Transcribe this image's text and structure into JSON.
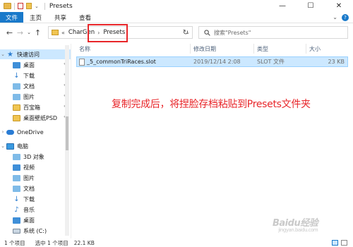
{
  "window": {
    "title": "Presets",
    "controls": {
      "minimize": "—",
      "maximize": "☐",
      "close": "✕"
    }
  },
  "ribbon": {
    "tabs": [
      "文件",
      "主页",
      "共享",
      "查看"
    ],
    "expand_glyph": "⌄",
    "help_glyph": "?"
  },
  "address": {
    "back": "←",
    "forward": "→",
    "recent": "⌄",
    "up": "↑",
    "overflow": "«",
    "crumbs": [
      "CharGen",
      "Presets"
    ],
    "separator": "›",
    "dropdown": "⌄",
    "refresh": "↻"
  },
  "search": {
    "placeholder": "搜索\"Presets\""
  },
  "sidebar": {
    "quick_access": "快速访问",
    "quick_items": [
      {
        "label": "桌面",
        "icon": "desktop-icon",
        "pinned": true
      },
      {
        "label": "下载",
        "icon": "download-icon",
        "pinned": true
      },
      {
        "label": "文档",
        "icon": "documents-icon",
        "pinned": true
      },
      {
        "label": "图片",
        "icon": "pictures-icon",
        "pinned": true
      },
      {
        "label": "百宝箱",
        "icon": "folder-icon",
        "pinned": true
      },
      {
        "label": "桌面壁纸PSD",
        "icon": "folder-icon",
        "pinned": true
      }
    ],
    "onedrive": "OneDrive",
    "this_pc": "电脑",
    "pc_items": [
      {
        "label": "3D 对象",
        "icon": "3d-objects-icon"
      },
      {
        "label": "视频",
        "icon": "videos-icon"
      },
      {
        "label": "图片",
        "icon": "pictures-icon"
      },
      {
        "label": "文档",
        "icon": "documents-icon"
      },
      {
        "label": "下载",
        "icon": "download-icon"
      },
      {
        "label": "音乐",
        "icon": "music-icon"
      },
      {
        "label": "桌面",
        "icon": "desktop-icon"
      },
      {
        "label": "系统 (C:)",
        "icon": "drive-icon"
      }
    ]
  },
  "columns": {
    "name": "名称",
    "modified": "修改日期",
    "type": "类型",
    "size": "大小"
  },
  "files": [
    {
      "name": "_5_commonTriRaces.slot",
      "modified": "2019/12/14 2:08",
      "type": "SLOT 文件",
      "size": "23 KB"
    }
  ],
  "annotation": "复制完成后，将捏脸存档粘贴到Presets文件夹",
  "status": {
    "count": "1 个项目",
    "selected": "选中 1 个项目",
    "size": "22.1 KB"
  },
  "watermark": {
    "text": "Baidu经验",
    "sub": "jingyan.baidu.com"
  },
  "colors": {
    "accent": "#1979ca",
    "selection": "#cce8ff",
    "annotation_red": "#e8262a"
  }
}
